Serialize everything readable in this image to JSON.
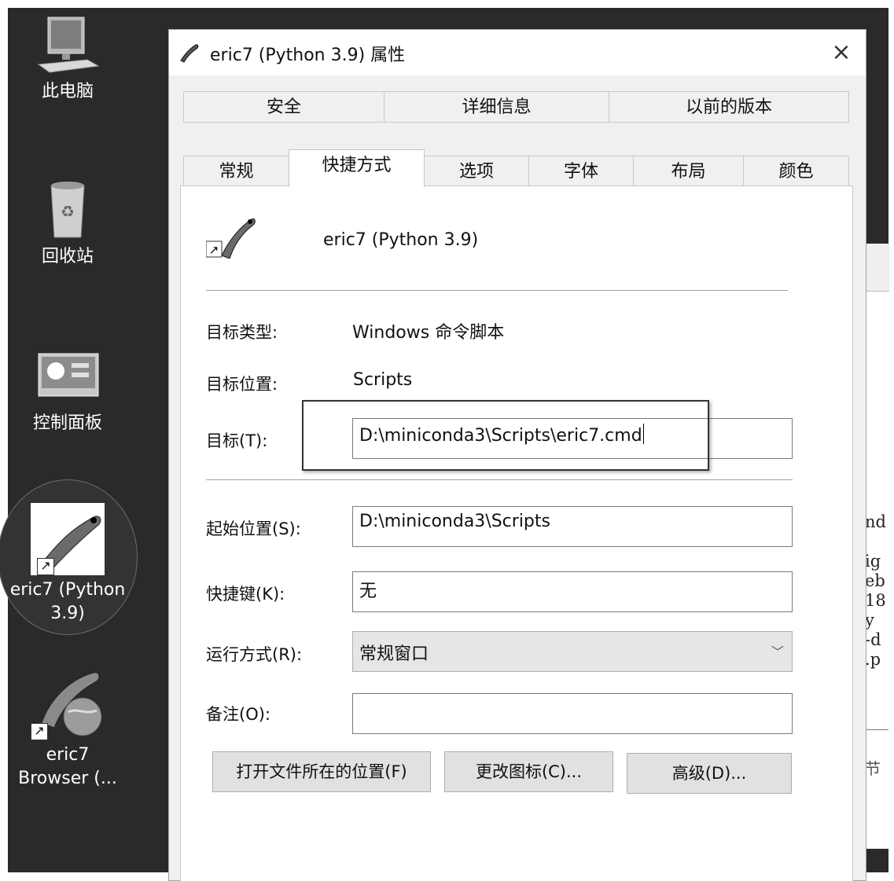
{
  "desktop": {
    "icons": [
      {
        "label": "此电脑"
      },
      {
        "label": "回收站"
      },
      {
        "label": "控制面板"
      },
      {
        "label_line1": "eric7 (Python",
        "label_line2": "3.9)"
      },
      {
        "label_line1": "eric7",
        "label_line2": "Browser (..."
      }
    ],
    "background_window": {
      "lines": "nd\n\nig\neb\n18\ny \n-d\n.p",
      "cn_text": "节"
    }
  },
  "dialog": {
    "title": "eric7 (Python 3.9) 属性",
    "close_symbol": "×",
    "tabs_row1": [
      "安全",
      "详细信息",
      "以前的版本"
    ],
    "tabs_row2": [
      "常规",
      "快捷方式",
      "选项",
      "字体",
      "布局",
      "颜色"
    ],
    "active_tab": "快捷方式",
    "shortcut_name": "eric7 (Python 3.9)",
    "target_type_label": "目标类型:",
    "target_type_value": "Windows 命令脚本",
    "target_location_label": "目标位置:",
    "target_location_value": "Scripts",
    "target_label": "目标(T):",
    "target_value": "D:\\miniconda3\\Scripts\\eric7.cmd",
    "start_in_label": "起始位置(S):",
    "start_in_value": "D:\\miniconda3\\Scripts",
    "hotkey_label": "快捷键(K):",
    "hotkey_value": "无",
    "run_label": "运行方式(R):",
    "run_value": "常规窗口",
    "comment_label": "备注(O):",
    "comment_value": "",
    "buttons": {
      "open_location": "打开文件所在的位置(F)",
      "change_icon": "更改图标(C)...",
      "advanced": "高级(D)..."
    }
  }
}
